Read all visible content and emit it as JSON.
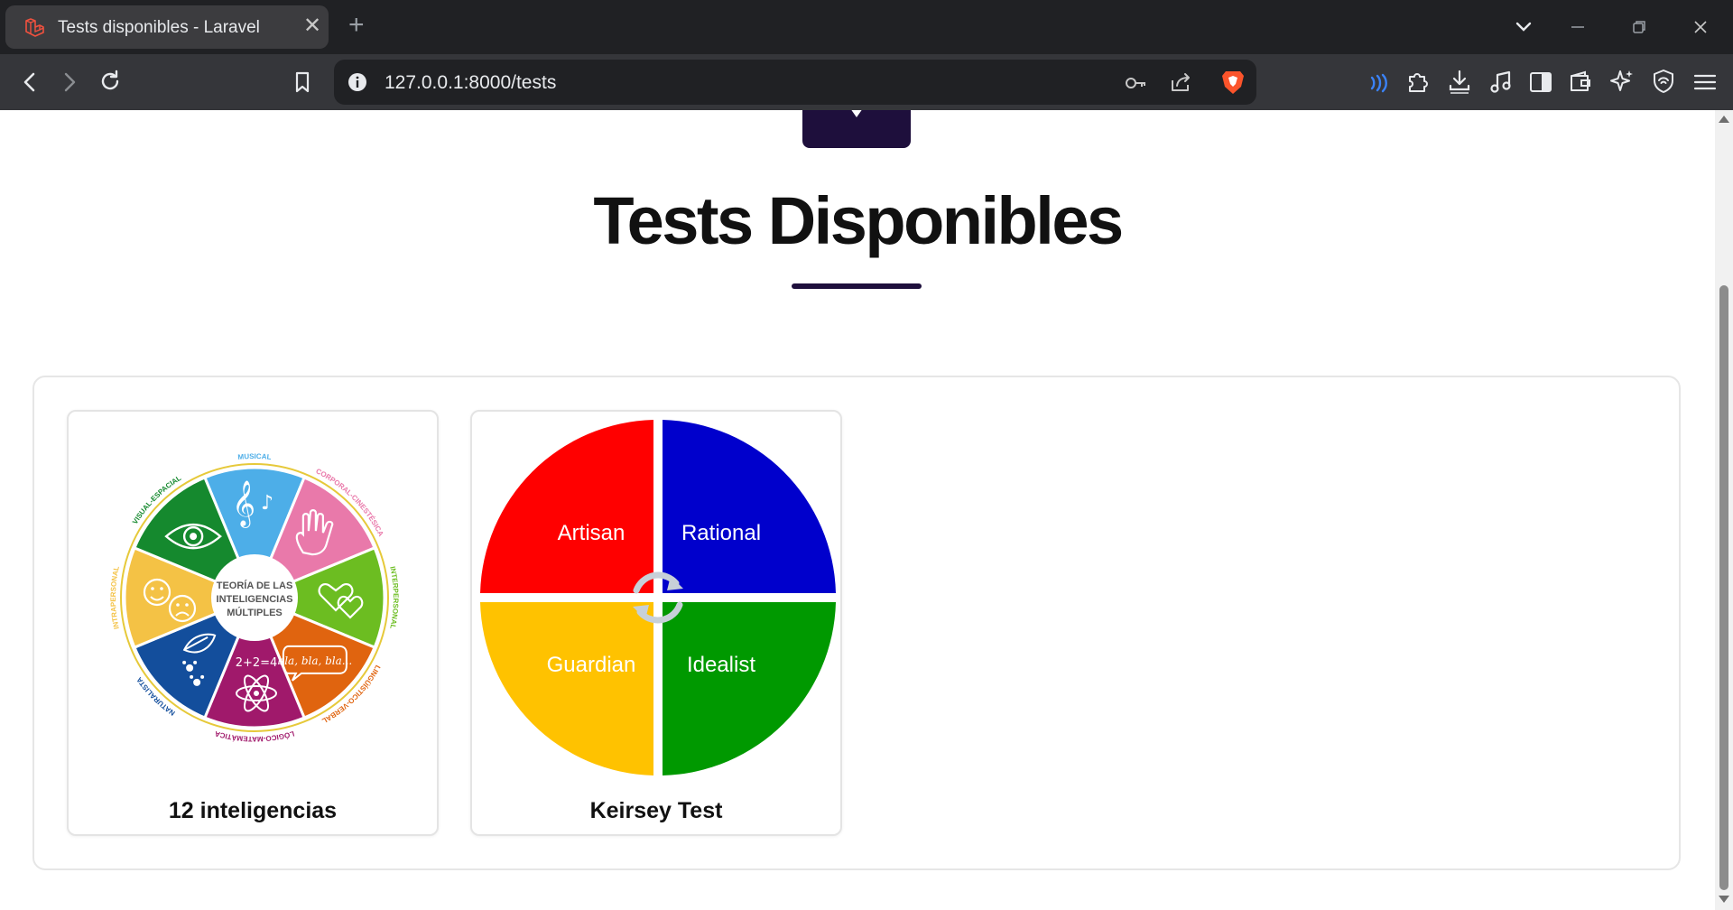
{
  "browser": {
    "tab": {
      "title": "Tests disponibles - Laravel",
      "favicon": "laravel-icon"
    },
    "url": "127.0.0.1:8000/tests",
    "icons": [
      "back-icon",
      "forward-icon",
      "reload-icon",
      "bookmark-icon",
      "site-info-icon",
      "key-icon",
      "share-icon",
      "brave-shield-icon",
      "speedreader-icon",
      "extensions-icon",
      "download-icon",
      "media-icon",
      "sidebar-icon",
      "wallet-icon",
      "leo-icon",
      "vpn-icon",
      "menu-icon"
    ]
  },
  "page": {
    "heading": "Tests Disponibles",
    "tests": [
      {
        "title": "12 inteligencias",
        "image": {
          "center_lines": [
            "TEORÍA DE LAS",
            "INTELIGENCIAS",
            "MÚLTIPLES"
          ],
          "segment_labels": [
            "MUSICAL",
            "CORPORAL-CINESTÉSICA",
            "INTERPERSONAL",
            "LINGÜÍSTICO-VERBAL",
            "LÓGICO-MATEMÁTICA",
            "NATURALISTA",
            "INTRAPERSONAL",
            "VISUAL-ESPACIAL"
          ],
          "speech_bubble": "bla, bla, bla...",
          "math_text": "2+2=4",
          "colors": [
            "#4daee8",
            "#e979aa",
            "#6cbd21",
            "#e0640f",
            "#a0196b",
            "#134e9c",
            "#f4c245",
            "#15892e"
          ]
        }
      },
      {
        "title": "Keirsey Test",
        "image": {
          "quadrants": [
            "Artisan",
            "Rational",
            "Guardian",
            "Idealist"
          ],
          "colors": [
            "#ff0000",
            "#0000cc",
            "#ffc200",
            "#009900"
          ]
        }
      }
    ]
  }
}
